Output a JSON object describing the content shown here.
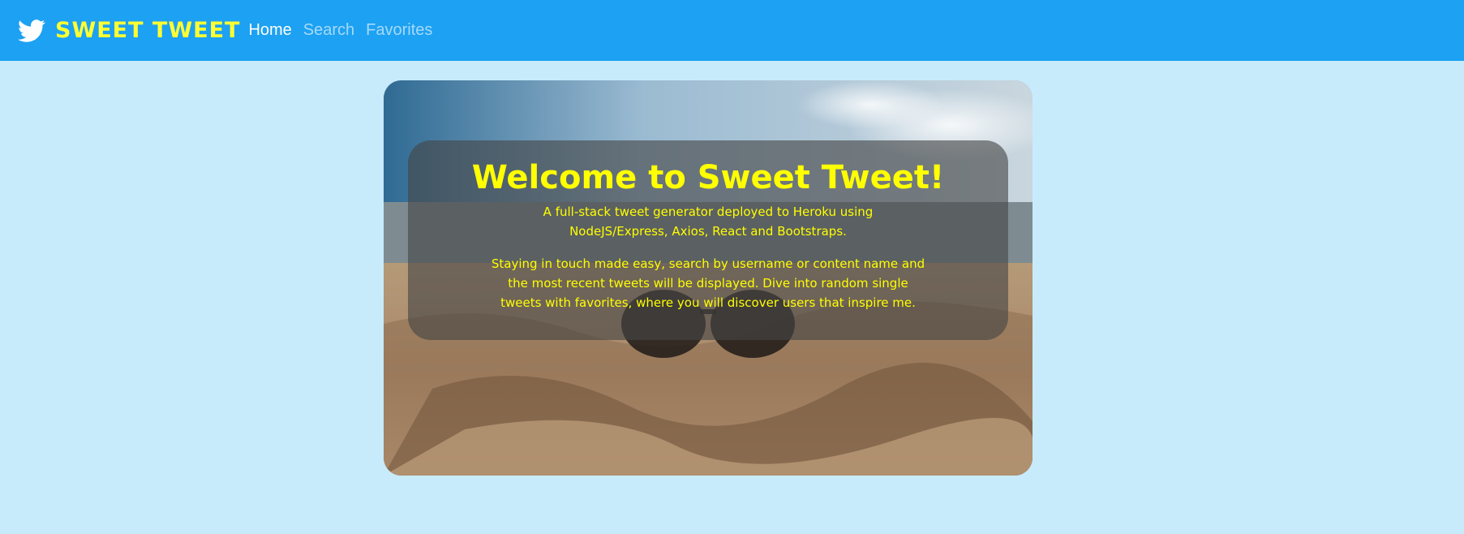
{
  "navbar": {
    "brand": "SWEET TWEET",
    "logo_icon": "twitter-bird-icon",
    "links": [
      {
        "label": "Home",
        "active": true
      },
      {
        "label": "Search",
        "active": false
      },
      {
        "label": "Favorites",
        "active": false
      }
    ],
    "bg_color": "#1da1f2",
    "brand_color": "#ffff33"
  },
  "hero": {
    "title": "Welcome to Sweet Tweet!",
    "subtitle": "A full-stack tweet generator deployed to Heroku using NodeJS/Express, Axios, React and Bootstraps.",
    "description": "Staying in touch made easy, search by username or content name and the most recent tweets will be displayed. Dive into random single tweets with favorites, where you will discover users that inspire me.",
    "image": "beach-sunglasses-image",
    "text_color": "#ffff00"
  },
  "page": {
    "bg_color": "#c8ebfc"
  }
}
